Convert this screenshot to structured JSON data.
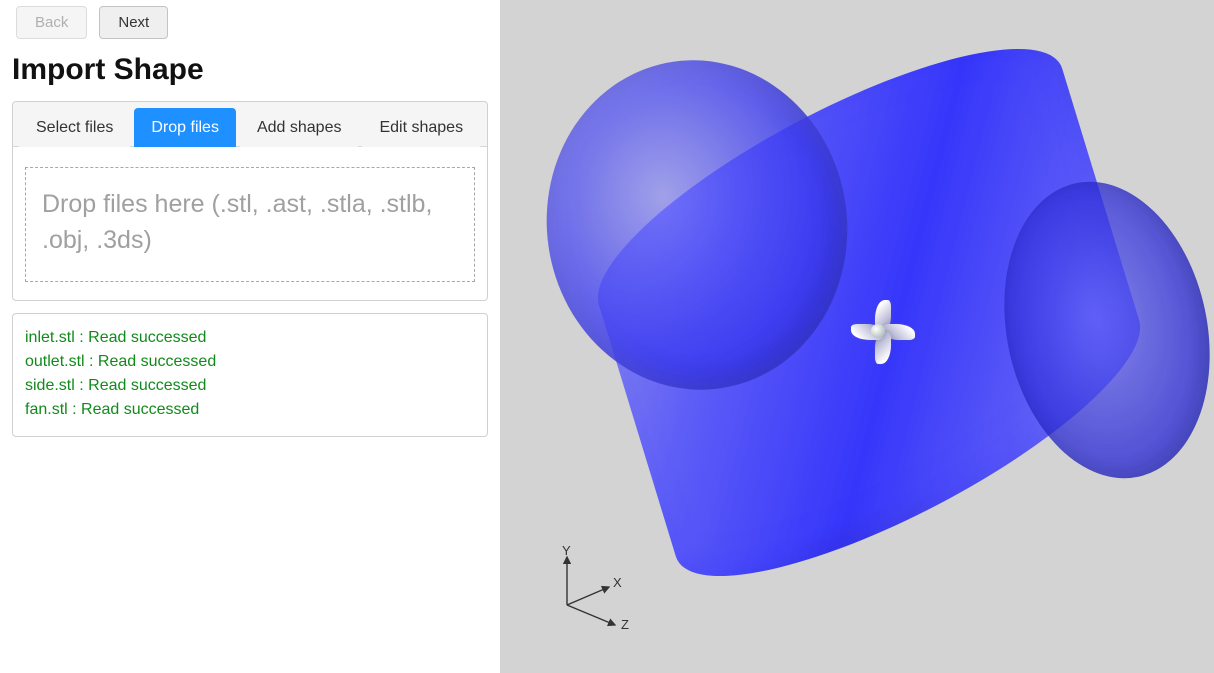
{
  "nav": {
    "back_label": "Back",
    "next_label": "Next"
  },
  "title": "Import Shape",
  "tabs": [
    {
      "label": "Select files"
    },
    {
      "label": "Drop files"
    },
    {
      "label": "Add shapes"
    },
    {
      "label": "Edit shapes"
    }
  ],
  "drop_hint": "Drop files here (.stl, .ast, .stla, .stlb, .obj, .3ds)",
  "log": [
    "inlet.stl : Read successed",
    "outlet.stl : Read successed",
    "side.stl : Read successed",
    "fan.stl : Read successed"
  ],
  "axes": {
    "x": "X",
    "y": "Y",
    "z": "Z"
  }
}
